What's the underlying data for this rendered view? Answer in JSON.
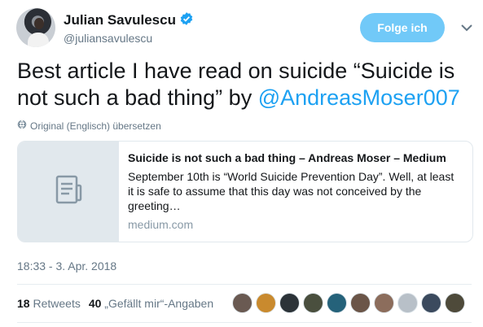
{
  "author": {
    "name": "Julian Savulescu",
    "handle": "@juliansavulescu",
    "verified_icon": "verified-badge-icon",
    "avatar_icon": "avatar-photo"
  },
  "follow_button": {
    "label": "Folge ich"
  },
  "menu": {
    "icon": "chevron-down-icon"
  },
  "tweet": {
    "text_before": "Best article I have read on suicide “Suicide is not such a bad thing” by ",
    "mention": "@AndreasMoser007"
  },
  "translate": {
    "label": "Original (Englisch) übersetzen",
    "icon": "globe-icon"
  },
  "card": {
    "title": "Suicide is not such a bad thing – Andreas Moser – Medium",
    "description": "September 10th is “World Suicide Prevention Day”. Well, at least it is safe to assume that this day was not conceived by the greeting…",
    "domain": "medium.com",
    "thumb_icon": "document-icon"
  },
  "timestamp": "18:33 - 3. Apr. 2018",
  "stats": {
    "retweets_count": "18",
    "retweets_label": "Retweets",
    "likes_count": "40",
    "likes_label": "„Gefällt mir“-Angaben"
  },
  "colors": {
    "accent": "#1da1f2",
    "follow_button": "#71c9f8",
    "secondary_text": "#657786"
  },
  "likers": [
    "#6a5a52",
    "#c98a2e",
    "#2c3338",
    "#4a4f3e",
    "#25627a",
    "#6b5548",
    "#8c6d5c",
    "#b8c0c8",
    "#3b4a5e",
    "#4e4a3a"
  ]
}
